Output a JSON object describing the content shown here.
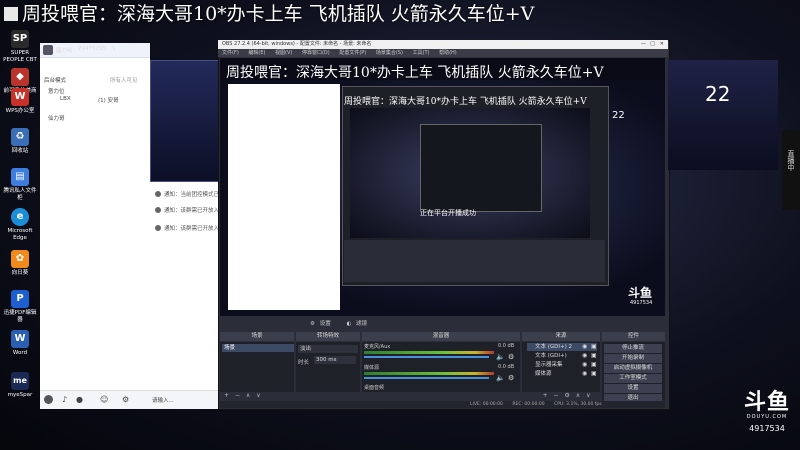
{
  "banner": {
    "text": "周投喂官：深海大哥10*办卡上车 飞机插队 火箭永久车位+V"
  },
  "overlay": {
    "number_right": "22",
    "room_id": "4917534",
    "logo_text": "斗鱼",
    "logo_sub": "DOUYU.COM"
  },
  "desktop_icons": [
    {
      "label": "SUPER PEOPLE CBT",
      "glyph": "SP",
      "color": "#2a2a2a"
    },
    {
      "label": "前可遨的美商",
      "glyph": "◆",
      "color": "#b8342c"
    },
    {
      "label": "WPS办公室",
      "glyph": "W",
      "color": "#c8322b"
    },
    {
      "label": "回收站",
      "glyph": "♻",
      "color": "#3a6fb7"
    },
    {
      "label": "腾讯私人文件柜",
      "glyph": "▤",
      "color": "#3d7de0"
    },
    {
      "label": "Microsoft Edge",
      "glyph": "e",
      "color": "#1b8ed8"
    },
    {
      "label": "向日葵",
      "glyph": "✿",
      "color": "#f08a1d"
    },
    {
      "label": "迅捷PDF编辑器",
      "glyph": "P",
      "color": "#1d5fd0"
    },
    {
      "label": "Word",
      "glyph": "W",
      "color": "#2b5fb4"
    },
    {
      "label": "myeSpar",
      "glyph": "me",
      "color": "#1a2a55"
    }
  ],
  "chat": {
    "user_name": "唐力哈",
    "user_id": "24475295",
    "online_count": "1",
    "group_label": "后台模式",
    "group_sub": "所有人可见",
    "tree_items": [
      "意力位",
      "LBX",
      "(1) 安哥",
      "仙力哥"
    ],
    "notices": [
      "通知：当前团控模式已开启",
      "通知：该群需已开放入",
      "通知：该群需已开放入"
    ],
    "input_placeholder": "请输入..."
  },
  "obs": {
    "title": "OBS 27.2.4 (64-bit, windows) - 配置文件: 未命名 - 场景: 未命名",
    "menu": [
      "文件(F)",
      "编辑(E)",
      "视图(V)",
      "停靠窗口(D)",
      "配置文件(P)",
      "场景集合(S)",
      "工具(T)",
      "帮助(H)"
    ],
    "toolbar": [
      "设置",
      "滤镜"
    ],
    "panels": [
      "场景",
      "来源",
      "混音器",
      "转场特效",
      "控件"
    ],
    "scenes": [
      "场景"
    ],
    "sources": [
      "文本 (GDI+) 2",
      "文本 (GDI+)",
      "显示器采集",
      "媒体源"
    ],
    "mixer": [
      {
        "name": "麦克风/Aux",
        "value": "0.0 dB"
      },
      {
        "name": "媒体源",
        "value": "0.0 dB"
      },
      {
        "name": "桌面音频",
        "value": "0.0 dB"
      }
    ],
    "transition": {
      "type": "淡出",
      "duration_label": "时长",
      "duration": "300 ms"
    },
    "controls": [
      "停止推流",
      "开始录制",
      "启动虚拟摄像机",
      "工作室模式",
      "设置",
      "退出"
    ],
    "status": [
      "LIVE: 00:00:00",
      "REC: 00:00:00",
      "CPU: 3.1%, 30.00 fps"
    ]
  },
  "preview": {
    "nested_banner": "周投喂官：深海大哥10*办卡上车 飞机插队 火箭永久车位+V",
    "nested_banner_2": "周投喂官：深海大哥10*办卡上车 飞机插队 火箭永久车位+V",
    "nested_message": "正在平台开播成功",
    "nested_number": "22",
    "nested_room_id": "4917534",
    "nested_logo": "斗鱼"
  },
  "right_side": {
    "vertical_text": "直播中"
  }
}
